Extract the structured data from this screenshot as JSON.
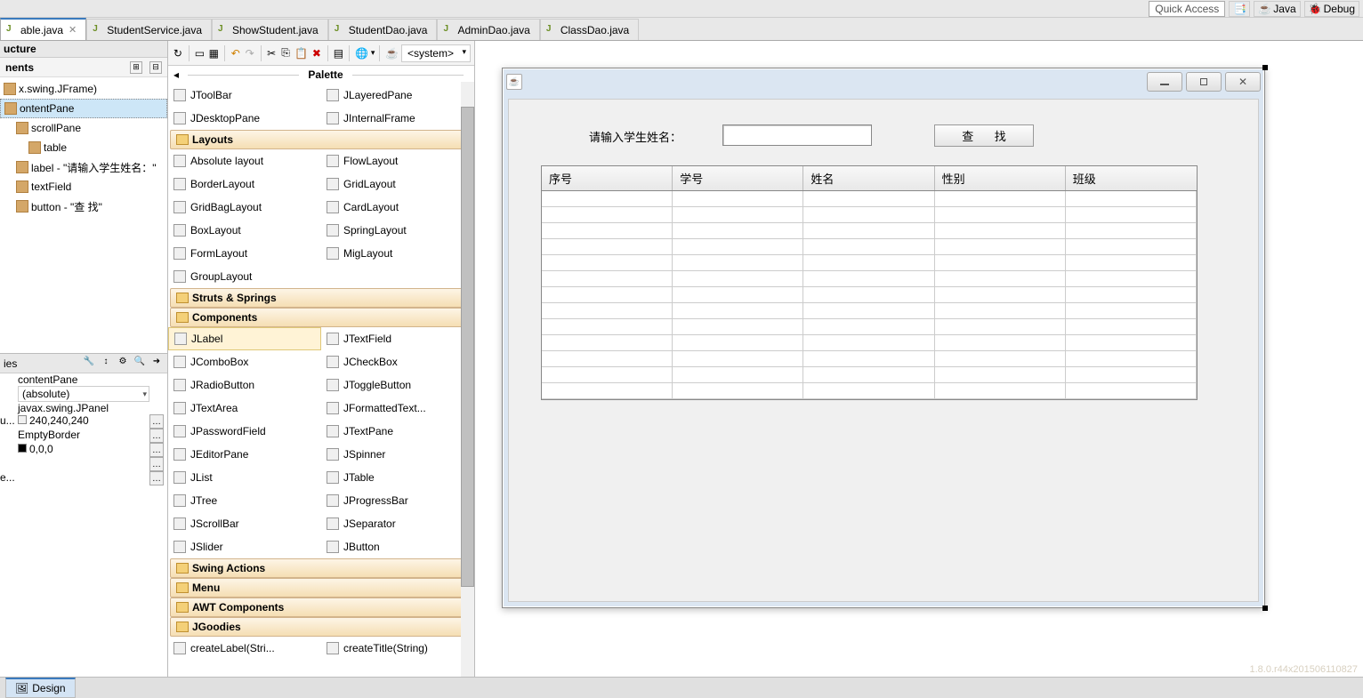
{
  "quick_access": "Quick Access",
  "perspectives": {
    "java": "Java",
    "debug": "Debug"
  },
  "tabs": [
    {
      "label": "able.java",
      "active": true
    },
    {
      "label": "StudentService.java",
      "active": false
    },
    {
      "label": "ShowStudent.java",
      "active": false
    },
    {
      "label": "StudentDao.java",
      "active": false
    },
    {
      "label": "AdminDao.java",
      "active": false
    },
    {
      "label": "ClassDao.java",
      "active": false
    }
  ],
  "structure": {
    "title": "ucture",
    "sub": "nents",
    "tree": [
      {
        "label": "x.swing.JFrame)",
        "indent": 0
      },
      {
        "label": "ontentPane",
        "indent": 0,
        "selected": true
      },
      {
        "label": "scrollPane",
        "indent": 1
      },
      {
        "label": "table",
        "indent": 2
      },
      {
        "label": "label - \"请输入学生姓名：\"",
        "indent": 1
      },
      {
        "label": "textField",
        "indent": 1
      },
      {
        "label": "button - \"查  找\"",
        "indent": 1
      }
    ]
  },
  "properties": {
    "title": "ies",
    "rows": [
      {
        "k": "",
        "v": "contentPane",
        "highlight": true
      },
      {
        "k": "",
        "v": "(absolute)",
        "combo": true
      },
      {
        "k": "",
        "v": "javax.swing.JPanel"
      },
      {
        "k": "u...",
        "v": "240,240,240",
        "chip": "#f0f0f0",
        "dots": true
      },
      {
        "k": "",
        "v": "EmptyBorder",
        "dots": true
      },
      {
        "k": "",
        "v": "0,0,0",
        "chip": "#000000",
        "dots": true
      },
      {
        "k": "",
        "v": "",
        "dots": true
      },
      {
        "k": "e...",
        "v": "",
        "dots": true
      }
    ]
  },
  "palette": {
    "title": "Palette",
    "system": "<system>",
    "sections": [
      {
        "type": "items",
        "items": [
          [
            "JToolBar",
            "JLayeredPane"
          ],
          [
            "JDesktopPane",
            "JInternalFrame"
          ]
        ]
      },
      {
        "type": "folder",
        "label": "Layouts"
      },
      {
        "type": "items",
        "items": [
          [
            "Absolute layout",
            "FlowLayout"
          ],
          [
            "BorderLayout",
            "GridLayout"
          ],
          [
            "GridBagLayout",
            "CardLayout"
          ],
          [
            "BoxLayout",
            "SpringLayout"
          ],
          [
            "FormLayout",
            "MigLayout"
          ],
          [
            "GroupLayout",
            ""
          ]
        ]
      },
      {
        "type": "folder",
        "label": "Struts & Springs"
      },
      {
        "type": "folder",
        "label": "Components"
      },
      {
        "type": "items",
        "items": [
          [
            "JLabel",
            "JTextField"
          ],
          [
            "JComboBox",
            "JCheckBox"
          ],
          [
            "JRadioButton",
            "JToggleButton"
          ],
          [
            "JTextArea",
            "JFormattedText..."
          ],
          [
            "JPasswordField",
            "JTextPane"
          ],
          [
            "JEditorPane",
            "JSpinner"
          ],
          [
            "JList",
            "JTable"
          ],
          [
            "JTree",
            "JProgressBar"
          ],
          [
            "JScrollBar",
            "JSeparator"
          ],
          [
            "JSlider",
            "JButton"
          ]
        ],
        "selectedIndex": 0
      },
      {
        "type": "folder",
        "label": "Swing Actions"
      },
      {
        "type": "folder",
        "label": "Menu"
      },
      {
        "type": "folder",
        "label": "AWT Components"
      },
      {
        "type": "folder",
        "label": "JGoodies"
      },
      {
        "type": "items",
        "items": [
          [
            "createLabel(Stri...",
            "createTitle(String)"
          ]
        ]
      }
    ]
  },
  "design_form": {
    "label_text": "请输入学生姓名：",
    "button_text": "查  找",
    "table_headers": [
      "序号",
      "学号",
      "姓名",
      "性别",
      "班级"
    ],
    "table_rows": 13
  },
  "version_stamp": "1.8.0.r44x201506110827",
  "bottom_tab": "Design"
}
